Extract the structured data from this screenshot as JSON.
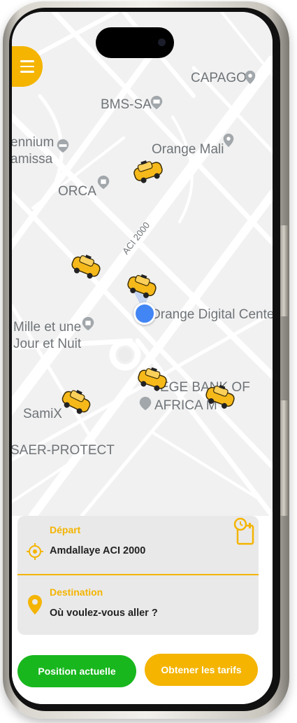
{
  "map": {
    "pois": {
      "capago": "CAPAGO",
      "bms": "BMS-SA",
      "millennium_line1": "ennium",
      "millennium_line2": "amissa",
      "orange_mali": "Orange Mali",
      "orca": "ORCA",
      "street": "ACI 2000",
      "mille_line1": "Mille et une",
      "mille_line2": "Jour et Nuit",
      "orange_digital": "Orange Digital Center",
      "bank_line1": "EGE BANK OF",
      "bank_line2": "AFRICA M",
      "samix": "SamiX",
      "saer": "SAER-PROTECT"
    },
    "taxi_count": 6
  },
  "colors": {
    "accent": "#f4b400",
    "green": "#19b71e",
    "location_blue": "#4285f4"
  },
  "booking": {
    "depart_label": "Départ",
    "depart_value": "Amdallaye ACI 2000",
    "destination_label": "Destination",
    "destination_placeholder": "Où voulez-vous aller ?"
  },
  "actions": {
    "current_position": "Position actuelle",
    "get_rates": "Obtener les tarifs"
  },
  "icons": {
    "menu": "hamburger-menu-icon",
    "schedule": "calendar-clock-icon",
    "target": "crosshair-icon",
    "destination_pin": "map-pin-icon",
    "taxi": "taxi-car-icon"
  }
}
